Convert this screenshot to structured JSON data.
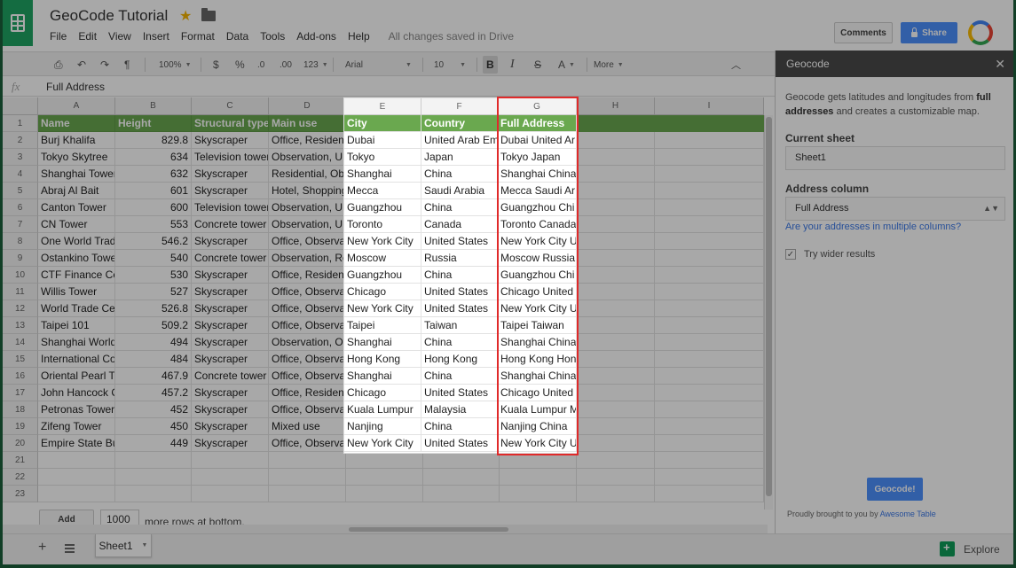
{
  "app": {
    "title": "GeoCode Tutorial",
    "menu": [
      "File",
      "Edit",
      "View",
      "Insert",
      "Format",
      "Data",
      "Tools",
      "Add-ons",
      "Help"
    ],
    "save_status": "All changes saved in Drive",
    "comments_label": "Comments",
    "share_label": "Share"
  },
  "toolbar": {
    "zoom": "100%",
    "currency": "$",
    "percent": "%",
    "decrease_decimals": ".0",
    "increase_decimals": ".00",
    "more_formats": "123",
    "font": "Arial",
    "font_size": "10",
    "bold": "B",
    "italic": "I",
    "strike": "S",
    "text_color": "A",
    "more": "More"
  },
  "formula": {
    "fx": "fx",
    "content": "Full Address"
  },
  "grid": {
    "columns": [
      "A",
      "B",
      "C",
      "D",
      "E",
      "F",
      "G",
      "H",
      "I"
    ],
    "row_numbers": [
      "1",
      "2",
      "3",
      "4",
      "5",
      "6",
      "7",
      "8",
      "9",
      "10",
      "11",
      "12",
      "13",
      "14",
      "15",
      "16",
      "17",
      "18",
      "19",
      "20",
      "21",
      "22",
      "23"
    ],
    "headers": [
      "Name",
      "Height",
      "Structural type",
      "Main use",
      "City",
      "Country",
      "Full Address"
    ],
    "rows": [
      [
        "Burj Khalifa",
        "829.8",
        "Skyscraper",
        "Office, Resident",
        "Dubai",
        "United Arab Em",
        "Dubai  United Ar"
      ],
      [
        "Tokyo Skytree",
        "634",
        "Television tower",
        "Observation, UH",
        "Tokyo",
        "Japan",
        "Tokyo  Japan"
      ],
      [
        "Shanghai Tower",
        "632",
        "Skyscraper",
        "Residential, Obs",
        "Shanghai",
        "China",
        "Shanghai  China"
      ],
      [
        "Abraj Al Bait",
        "601",
        "Skyscraper",
        "Hotel, Shopping",
        "Mecca",
        "Saudi Arabia",
        "Mecca  Saudi Ar"
      ],
      [
        "Canton Tower",
        "600",
        "Television tower",
        "Observation, UH",
        "Guangzhou",
        "China",
        "Guangzhou  Chi"
      ],
      [
        "CN Tower",
        "553",
        "Concrete tower",
        "Observation, UH",
        "Toronto",
        "Canada",
        "Toronto  Canada"
      ],
      [
        "One World Trad",
        "546.2",
        "Skyscraper",
        "Office, Observat",
        "New York City",
        "United States",
        "New York City  U"
      ],
      [
        "Ostankino Towe",
        "540",
        "Concrete tower",
        "Observation, Re",
        "Moscow",
        "Russia",
        "Moscow  Russia"
      ],
      [
        "CTF Finance Ce",
        "530",
        "Skyscraper",
        "Office, Resident",
        "Guangzhou",
        "China",
        "Guangzhou  Chi"
      ],
      [
        "Willis Tower",
        "527",
        "Skyscraper",
        "Office, Observat",
        "Chicago",
        "United States",
        "Chicago  United"
      ],
      [
        "World Trade Ce",
        "526.8",
        "Skyscraper",
        "Office, Observat",
        "New York City",
        "United States",
        "New York City  U"
      ],
      [
        "Taipei 101",
        "509.2",
        "Skyscraper",
        "Office, Observat",
        "Taipei",
        "Taiwan",
        "Taipei  Taiwan"
      ],
      [
        "Shanghai World",
        "494",
        "Skyscraper",
        "Observation, Of",
        "Shanghai",
        "China",
        "Shanghai  China"
      ],
      [
        "International Co",
        "484",
        "Skyscraper",
        "Office, Observat",
        "Hong Kong",
        "Hong Kong",
        "Hong Kong  Hon"
      ],
      [
        "Oriental Pearl T",
        "467.9",
        "Concrete tower",
        "Office, Observat",
        "Shanghai",
        "China",
        "Shanghai  China"
      ],
      [
        "John Hancock C",
        "457.2",
        "Skyscraper",
        "Office, Resident",
        "Chicago",
        "United States",
        "Chicago  United"
      ],
      [
        "Petronas Tower",
        "452",
        "Skyscraper",
        "Office, Observat",
        "Kuala Lumpur",
        "Malaysia",
        "Kuala Lumpur  M"
      ],
      [
        "Zifeng Tower",
        "450",
        "Skyscraper",
        "Mixed use",
        "Nanjing",
        "China",
        "Nanjing  China"
      ],
      [
        "Empire State Bu",
        "449",
        "Skyscraper",
        "Office, Observat",
        "New York City",
        "United States",
        "New York City  U"
      ]
    ],
    "add_label": "Add",
    "add_count": "1000",
    "add_suffix": "more rows at bottom."
  },
  "sheets": {
    "active": "Sheet1",
    "explore_label": "Explore"
  },
  "panel": {
    "title": "Geocode",
    "desc_1": "Geocode gets latitudes and longitudes from ",
    "desc_bold": "full addresses",
    "desc_2": " and creates a customizable map.",
    "current_sheet_label": "Current sheet",
    "current_sheet_value": "Sheet1",
    "address_column_label": "Address column",
    "address_column_value": "Full Address",
    "multi_columns_link": "Are your addresses in multiple columns?",
    "wider_results_label": "Try wider results",
    "geocode_button": "Geocode!",
    "credit_prefix": "Proudly brought to you by ",
    "credit_link": "Awesome Table"
  },
  "colors": {
    "header_green": "#6aa84f",
    "highlight_red": "#e02a2a",
    "sheets_green": "#1fa463",
    "button_blue": "#4d90fe"
  }
}
